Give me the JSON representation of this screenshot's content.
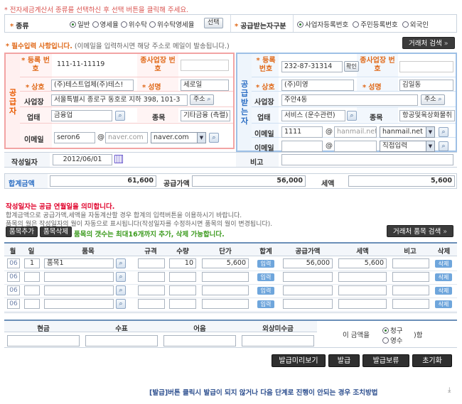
{
  "top_notice": "* 전자세금계산서 종류를 선택하신 후 선택 버튼을 클릭해 주세요.",
  "type_row": {
    "label": "종류",
    "opts": [
      "일반",
      "영세율",
      "위수탁",
      "위수탁영세율"
    ],
    "select_btn": "선택",
    "receiver_label": "공급받는자구분",
    "receiver_opts": [
      "사업자등록번호",
      "주민등록번호",
      "외국인"
    ]
  },
  "required_notice": {
    "head": "* 필수입력 사항입니다.",
    "body": "(이메일을 입력하시면 해당 주소로 메일이 발송됩니다.)"
  },
  "partner_search": "거래처 검색",
  "supplier": {
    "title": "공급자",
    "reg_label": "등록 번호",
    "reg_no": "111-11-11119",
    "branch_label": "종사업장 번호",
    "company_label": "상호",
    "company": "(주)테스트업체(주)테스!",
    "name_label": "성명",
    "name": "세로일",
    "addr_label": "사업장",
    "addr": "서울특별시 종로구 동호로 지하 398, 101-3",
    "addr_btn": "주소",
    "biz_label": "업태",
    "biz": "금융업",
    "item_label": "종목",
    "item": "기타금융 (측렬)",
    "email_label": "이메일",
    "email_id": "seron6",
    "email_domain": "naver.com",
    "email_select": "naver.com"
  },
  "buyer": {
    "title": "공급받는자",
    "reg_label": "등록 번호",
    "reg_no": "232-87-31314",
    "confirm": "확인",
    "branch_label": "종사업장 번호",
    "company_label": "상호",
    "company": "(주)미영",
    "name_label": "성명",
    "name": "김일동",
    "addr_label": "사업장",
    "addr": "주안4동",
    "addr_btn": "주소",
    "biz_label": "업태",
    "biz": "서비스 (운수관련)",
    "item_label": "종목",
    "item": "항공및육상화물취",
    "email_label": "이메일",
    "email_id": "1111",
    "email_domain": "hanmail.net",
    "email_select": "hanmail.net",
    "email2_label": "이메일",
    "email2_select": "직접입력"
  },
  "date_row": {
    "label": "작성일자",
    "date": "2012/06/01",
    "memo_label": "비고"
  },
  "totals": {
    "total_label": "합계금액",
    "total": "61,600",
    "supply_label": "공급가액",
    "supply": "56,000",
    "tax_label": "세액",
    "tax": "5,600"
  },
  "info": {
    "red": "작성일자는 공급 연월일을 의미합니다.",
    "line1": "합계금액으로 공급가액,세액을 자동계산할 경우 합계의 입력버튼을 이용하시기 바랍니다.",
    "line2": "품목의 월은 작성일자의 월이 자동으로 표시됩니다(작성일자를 수정하시면 품목의 월이 변경됩니다)."
  },
  "item_toolbar": {
    "add": "품목추가",
    "delete": "품목삭제",
    "hint": "품목의 갯수는 최대16개까지 추가, 삭제 가능합니다.",
    "search": "거래처 품목 검색"
  },
  "item_table": {
    "headers": [
      "월",
      "일",
      "품목",
      "규격",
      "수량",
      "단가",
      "합계",
      "공급가액",
      "세액",
      "비고",
      "삭제"
    ],
    "input_label": "입력",
    "delete_label": "삭제",
    "rows": [
      {
        "month": "06",
        "day": "1",
        "item": "품목1",
        "qty": "10",
        "price": "5,600",
        "supply": "56,000",
        "tax": "5,600"
      },
      {
        "month": "06",
        "day": "",
        "item": "",
        "qty": "",
        "price": "",
        "supply": "",
        "tax": ""
      },
      {
        "month": "06",
        "day": "",
        "item": "",
        "qty": "",
        "price": "",
        "supply": "",
        "tax": ""
      },
      {
        "month": "06",
        "day": "",
        "item": "",
        "qty": "",
        "price": "",
        "supply": "",
        "tax": ""
      }
    ]
  },
  "payment": {
    "headers": [
      "현금",
      "수표",
      "어음",
      "외상미수금"
    ],
    "prefix": "이 금액을",
    "opts": [
      "청구",
      "영수"
    ],
    "suffix": ")함"
  },
  "actions": {
    "preview": "발급미리보기",
    "issue": "발급",
    "hold": "발급보류",
    "reset": "초기화"
  },
  "footer": "[발급]버튼 클릭시 발급이 되지 않거나 다음 단계로 진행이 안되는 경우 조치방법"
}
